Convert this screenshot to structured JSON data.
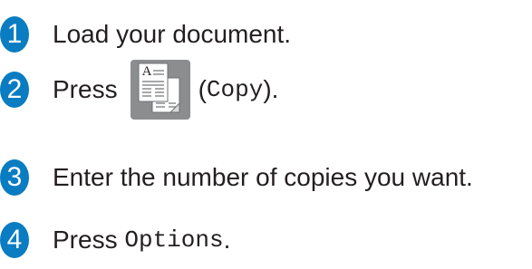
{
  "steps": [
    {
      "number": "1",
      "text": "Load your document."
    },
    {
      "number": "2",
      "prefix": "Press",
      "open_paren": "(",
      "code": "Copy",
      "suffix": ")."
    },
    {
      "number": "3",
      "text": "Enter the number of copies you want."
    },
    {
      "number": "4",
      "prefix": "Press",
      "code": "Options",
      "suffix": "."
    }
  ],
  "copy_icon_letter": "A",
  "colors": {
    "badge": "#0a7cc1",
    "icon_bg": "#8b8d8f",
    "text": "#231f20"
  },
  "icons": {
    "copy": "copy-document-icon"
  }
}
